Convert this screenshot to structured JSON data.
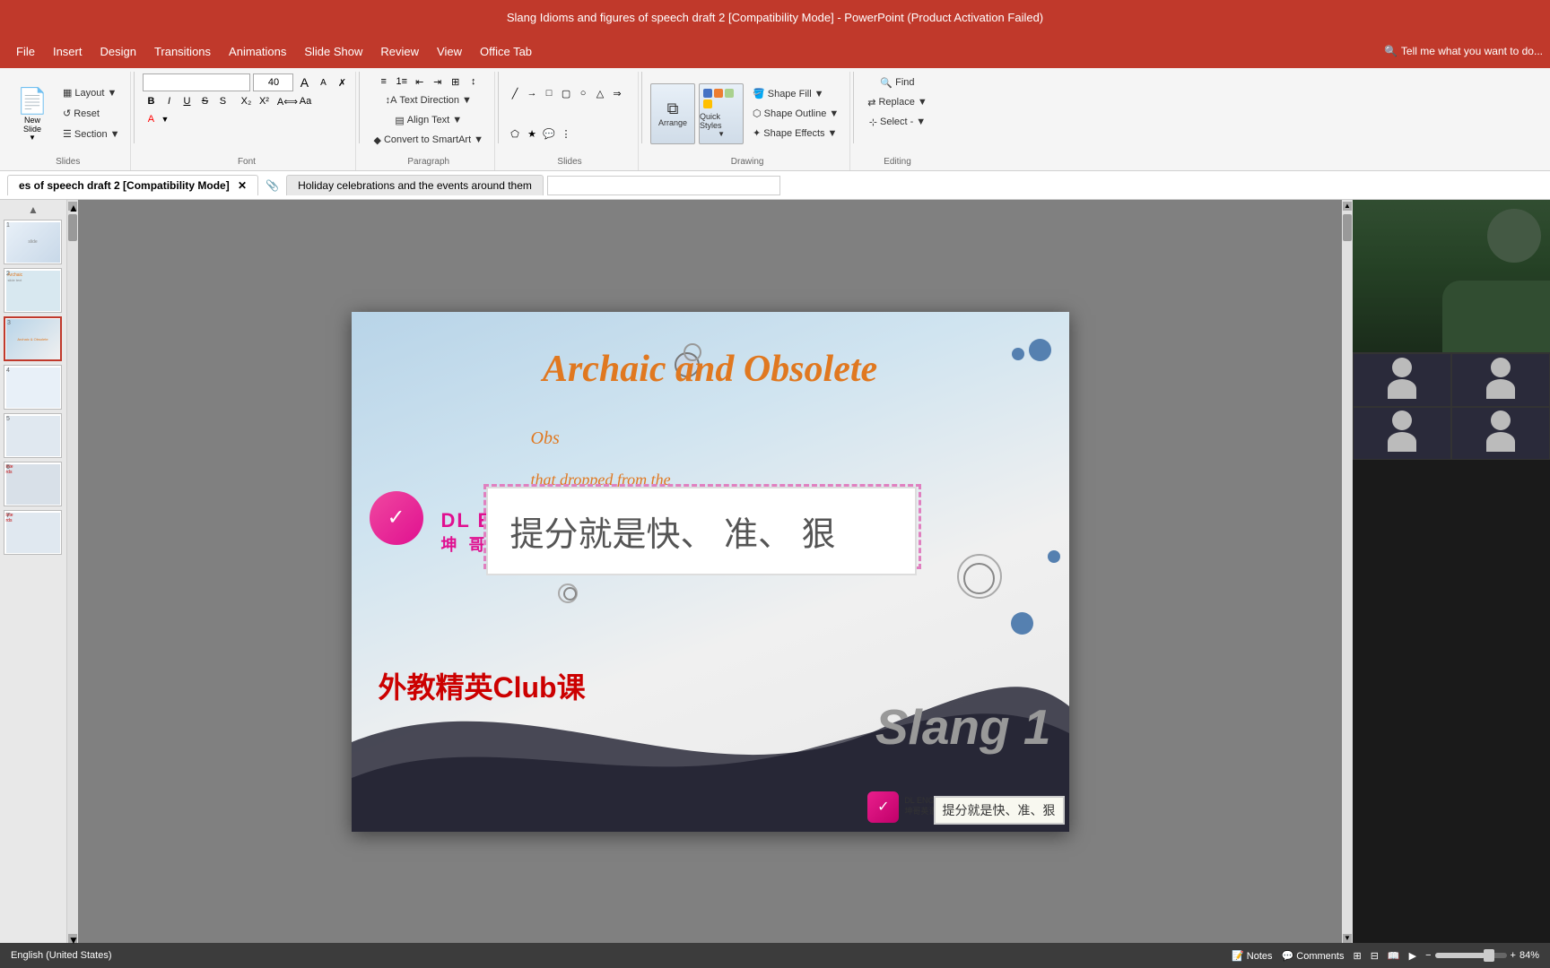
{
  "titlebar": {
    "text": "Slang Idioms and figures of speech draft 2 [Compatibility Mode] - PowerPoint (Product Activation Failed)"
  },
  "menubar": {
    "items": [
      "File",
      "Insert",
      "Design",
      "Transitions",
      "Animations",
      "Slide Show",
      "Review",
      "View",
      "Office Tab"
    ],
    "tell_me": "Tell me what you want to do..."
  },
  "ribbon": {
    "sections": {
      "slides": {
        "label": "Slides",
        "new_slide": "New\nSlide",
        "layout": "Layout",
        "reset": "Reset",
        "section": "Section"
      },
      "font": {
        "label": "Font",
        "font_name": "",
        "font_size": "40",
        "bold": "B",
        "italic": "I",
        "underline": "U",
        "strikethrough": "S",
        "shadow": "S"
      },
      "paragraph": {
        "label": "Paragraph",
        "text_direction": "Text Direction",
        "align_text": "Align Text",
        "convert_to_smartart": "Convert to SmartArt"
      },
      "drawing": {
        "label": "Drawing",
        "shape_fill": "Shape Fill",
        "shape_outline": "Shape Outline",
        "shape_effects": "Shape Effects",
        "arrange": "Arrange",
        "quick_styles": "Quick Styles"
      },
      "editing": {
        "label": "Editing",
        "find": "Find",
        "replace": "Replace",
        "select": "Select"
      }
    }
  },
  "tabs": {
    "active_tab": "Slang Idioms and figures of speech draft 2",
    "second_tab": "Holiday celebrations and the events around them"
  },
  "slide": {
    "title": "Archaic and Obsolete",
    "subtitle": "Obs",
    "body_text": "that dropped from the\nlanguage, \"no longer in use,",
    "chinese_text": "提分就是快、 准、 狠",
    "red_text": "外教精英Club课",
    "slang_text": "Slang 1",
    "logo_text_en": "DL ENGLISH",
    "logo_text_cn": "坤 哥 英 语",
    "bottom_chinese": "提分就是快、准、狠",
    "bottom_logo": "DL ENGLISH\n坤哥英语"
  },
  "status_bar": {
    "language": "English (United States)",
    "notes": "Notes",
    "comments": "Comments",
    "zoom": "84%"
  }
}
